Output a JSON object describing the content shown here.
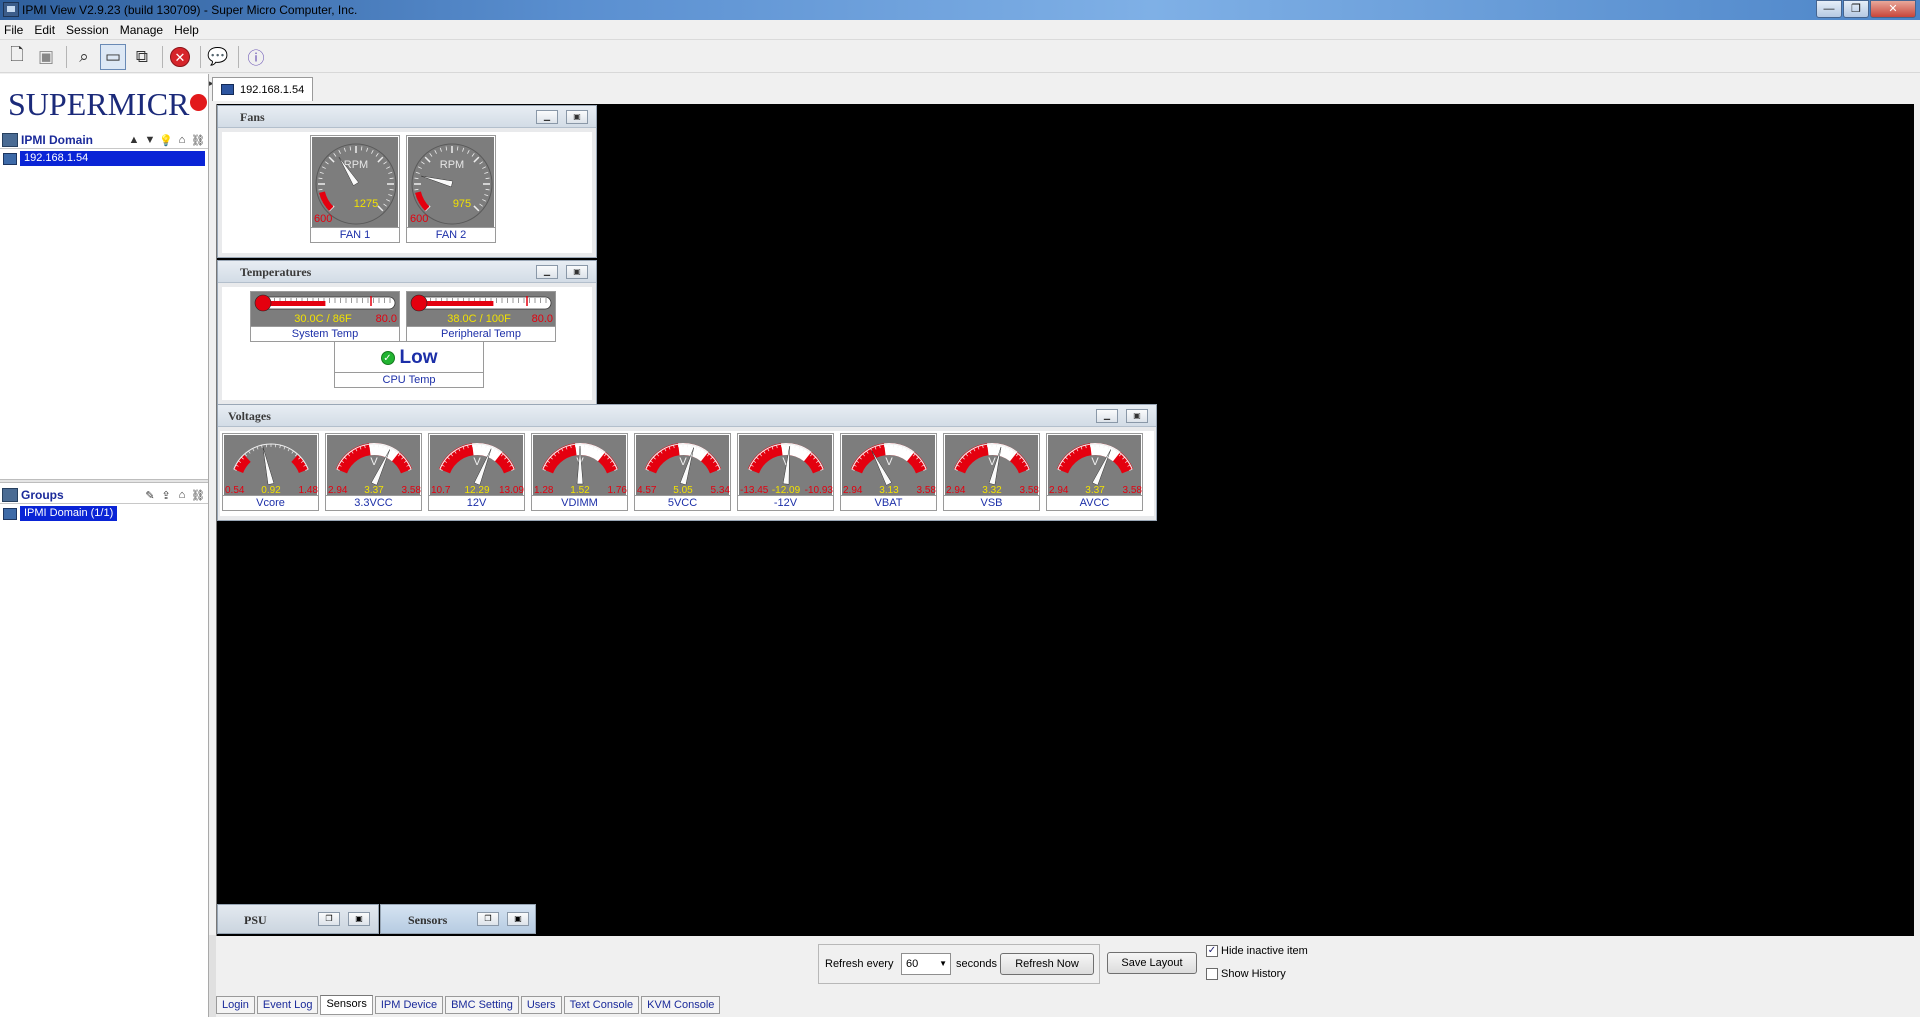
{
  "window": {
    "title": "IPMI View V2.9.23 (build 130709) - Super Micro Computer, Inc.",
    "min": "—",
    "max": "❐",
    "close": "✕"
  },
  "menu": [
    "File",
    "Edit",
    "Session",
    "Manage",
    "Help"
  ],
  "left": {
    "logo": "SUPERMICR",
    "domain_header": "IPMI Domain",
    "domain_item": "192.168.1.54",
    "groups_header": "Groups",
    "groups_item": "IPMI Domain (1/1)"
  },
  "session_tab": "192.168.1.54",
  "fans": {
    "title": "Fans",
    "unit": "RPM",
    "items": [
      {
        "label": "FAN 1",
        "value": "1275",
        "min": "600",
        "level": 0.38
      },
      {
        "label": "FAN 2",
        "value": "975",
        "min": "600",
        "level": 0.22
      }
    ]
  },
  "temperatures": {
    "title": "Temperatures",
    "items": [
      {
        "label": "System Temp",
        "value": "30.0C / 86F",
        "max": "80.0",
        "level": 0.52
      },
      {
        "label": "Peripheral Temp",
        "value": "38.0C / 100F",
        "max": "80.0",
        "level": 0.62
      }
    ],
    "cpu": {
      "label": "CPU Temp",
      "value": "Low",
      "status_color": "#22b432"
    }
  },
  "voltages": {
    "title": "Voltages",
    "unit": "V",
    "items": [
      {
        "label": "Vcore",
        "min": "0.54",
        "value": "0.92",
        "max": "1.48",
        "level": 0.41
      },
      {
        "label": "3.3VCC",
        "min": "2.94",
        "value": "3.37",
        "max": "3.58",
        "level": 0.68
      },
      {
        "label": "12V",
        "min": "10.7",
        "value": "12.29",
        "max": "13.09",
        "level": 0.66
      },
      {
        "label": "VDIMM",
        "min": "1.28",
        "value": "1.52",
        "max": "1.76",
        "level": 0.5
      },
      {
        "label": "5VCC",
        "min": "4.57",
        "value": "5.05",
        "max": "5.34",
        "level": 0.62
      },
      {
        "label": "-12V",
        "min": "-13.45",
        "value": "-12.09",
        "max": "-10.93",
        "level": 0.54
      },
      {
        "label": "VBAT",
        "min": "2.94",
        "value": "3.13",
        "max": "3.58",
        "level": 0.3
      },
      {
        "label": "VSB",
        "min": "2.94",
        "value": "3.32",
        "max": "3.58",
        "level": 0.6
      },
      {
        "label": "AVCC",
        "min": "2.94",
        "value": "3.37",
        "max": "3.58",
        "level": 0.68
      }
    ]
  },
  "mini_frames": [
    "PSU",
    "Sensors"
  ],
  "controls": {
    "refresh_label": "Refresh every",
    "refresh_value": "60",
    "seconds_label": "seconds",
    "refresh_now": "Refresh Now",
    "save_layout": "Save Layout",
    "hide_inactive": "Hide inactive item",
    "show_history": "Show History"
  },
  "bottom_tabs": [
    "Login",
    "Event Log",
    "Sensors",
    "IPM Device",
    "BMC Setting",
    "Users",
    "Text Console",
    "KVM Console"
  ],
  "colors": {
    "accent_red": "#e4000f",
    "gauge_bg": "#7d7d7d",
    "label_blue": "#1c2fa8",
    "workspace": "#000000"
  }
}
